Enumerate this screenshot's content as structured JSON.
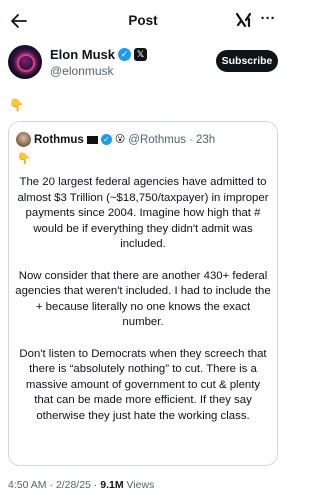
{
  "header": {
    "title": "Post",
    "back_icon": "back-arrow-icon",
    "grok_icon": "grok-icon",
    "more_icon": "more-icon",
    "more_label": "···"
  },
  "author": {
    "name": "Elon Musk",
    "handle": "@elonmusk",
    "verified": true,
    "subscribe_label": "Subscribe"
  },
  "post": {
    "text": "👇"
  },
  "quoted_post": {
    "name": "Rothmus",
    "flag_icon": "black-flag-icon",
    "emoji": "😮",
    "handle": "@Rothmus",
    "time": "· 23h",
    "pointer": "👇",
    "paragraphs": [
      "The 20 largest federal agencies have admitted to almost $3 Trillion (~$18,750/taxpayer) in improper payments since 2004. Imagine how high that # would be if everything they didn't admit was included.",
      "Now consider that there are another 430+ federal agencies that weren't included. I had to include the + because literally no one knows the exact number.",
      "Don't listen to Democrats when they screech that there is “absolutely nothing” to cut. There is a massive amount of government to cut & plenty that can be made more efficient. If they say otherwise they just hate the working class."
    ]
  },
  "meta": {
    "timestamp": "4:50 AM · 2/28/25 ·",
    "views_count": "9.1M",
    "views_label": "Views"
  },
  "colors": {
    "accent": "#1d9bf0",
    "text": "#0f1419",
    "muted": "#536471",
    "border": "#cfd9de"
  }
}
